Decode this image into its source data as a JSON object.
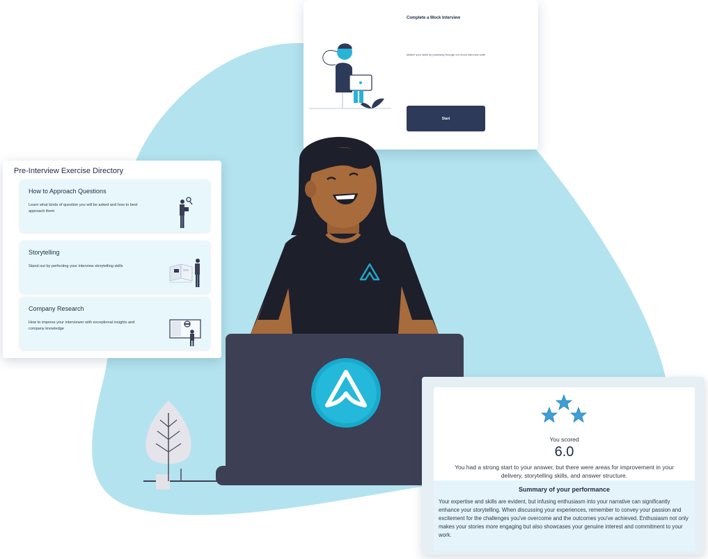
{
  "colors": {
    "blob": "#b3e3ef",
    "navy": "#2e3a59",
    "accent": "#1ea7c9",
    "card_tint": "#e8f7fb",
    "skin": "#a86b3c",
    "shirt": "#1d1f2b",
    "laptop": "#3d3f55",
    "star": "#3d9fd4"
  },
  "mock_interview": {
    "title": "Complete a Mock Interview",
    "description": "Master your skills by practising through our mock interview suite",
    "start_label": "Start",
    "illustration_icon": "person-with-laptop-illustration"
  },
  "directory": {
    "title": "Pre-Interview Exercise Directory",
    "items": [
      {
        "title": "How to Approach Questions",
        "description": "Learn what kinds of question you will be asked and how to best approach them",
        "icon": "person-with-magnifier-illustration"
      },
      {
        "title": "Storytelling",
        "description": "Stand out by perfecting your interview storytelling skills",
        "icon": "person-with-book-illustration"
      },
      {
        "title": "Company Research",
        "description": "How to impress your interviewer with exceptional insights and company knowledge",
        "icon": "person-with-screen-illustration"
      }
    ]
  },
  "center": {
    "logo_icon": "brand-a-logo-icon",
    "person_icon": "smiling-woman-illustration",
    "laptop_icon": "laptop-illustration",
    "plant_icon": "leaf-tree-illustration"
  },
  "score": {
    "stars_icon": "three-stars-icon",
    "label": "You scored",
    "value": "6.0",
    "message": "You had a strong start to your answer, but there were areas for improvement in your delivery, storytelling skills, and answer structure.",
    "summary_title": "Summary of your performance",
    "summary_body": "Your expertise and skills are evident, but infusing enthusiasm into your narrative can significantly enhance your storytelling. When discussing your experiences, remember to convey your passion and excitement for the challenges you've overcome and the outcomes you've achieved. Enthusiasm not only makes your stories more engaging but also showcases your genuine interest and commitment to your work."
  }
}
